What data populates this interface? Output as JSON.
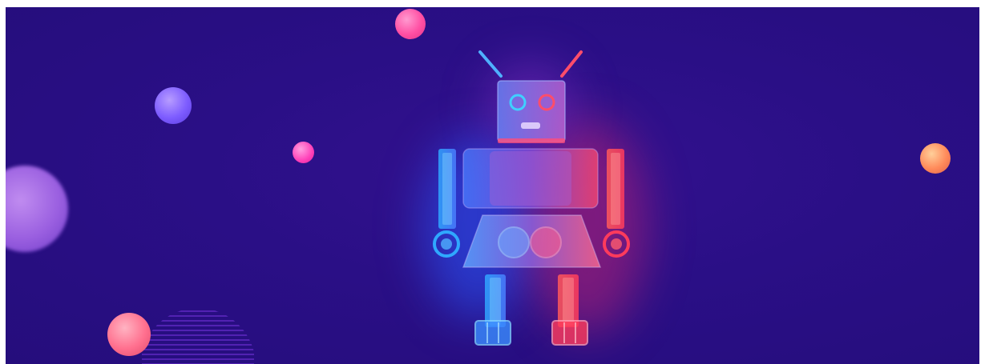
{
  "banner": {
    "background": "#2a0f86",
    "accent_blue": "#3f8cff",
    "accent_red": "#ff3b5c",
    "accent_pink": "#ff4fa3",
    "accent_violet": "#7d5cff"
  },
  "decorations": {
    "icon": "robot-illustration",
    "orbs": [
      "pink-orb",
      "violet-orb",
      "magenta-orb",
      "orange-orb",
      "lavender-orb",
      "coral-orb"
    ]
  }
}
